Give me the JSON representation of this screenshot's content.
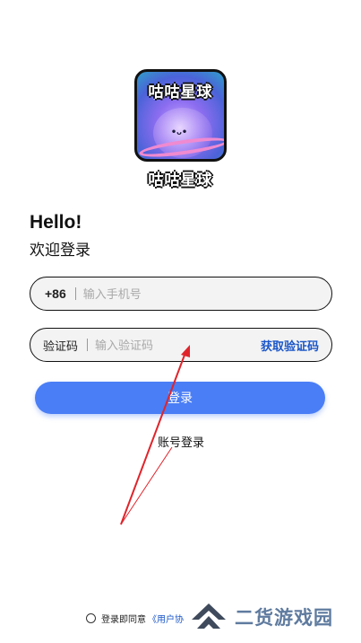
{
  "logo": {
    "text": "咕咕星球",
    "face": "•ᴗ•"
  },
  "app_name": "咕咕星球",
  "greeting": {
    "hello": "Hello!",
    "welcome": "欢迎登录"
  },
  "phone_field": {
    "prefix": "+86",
    "placeholder": "输入手机号"
  },
  "code_field": {
    "label": "验证码",
    "placeholder": "输入验证码",
    "get_code": "获取验证码"
  },
  "login_button": "登录",
  "account_login": "账号登录",
  "agreement": {
    "text": "登录即同意",
    "link": "《用户协"
  },
  "watermark": {
    "text": "二货游戏园"
  },
  "colors": {
    "primary": "#4a7ef6",
    "link": "#1a56c8",
    "annotation_arrow": "#e0242b"
  }
}
